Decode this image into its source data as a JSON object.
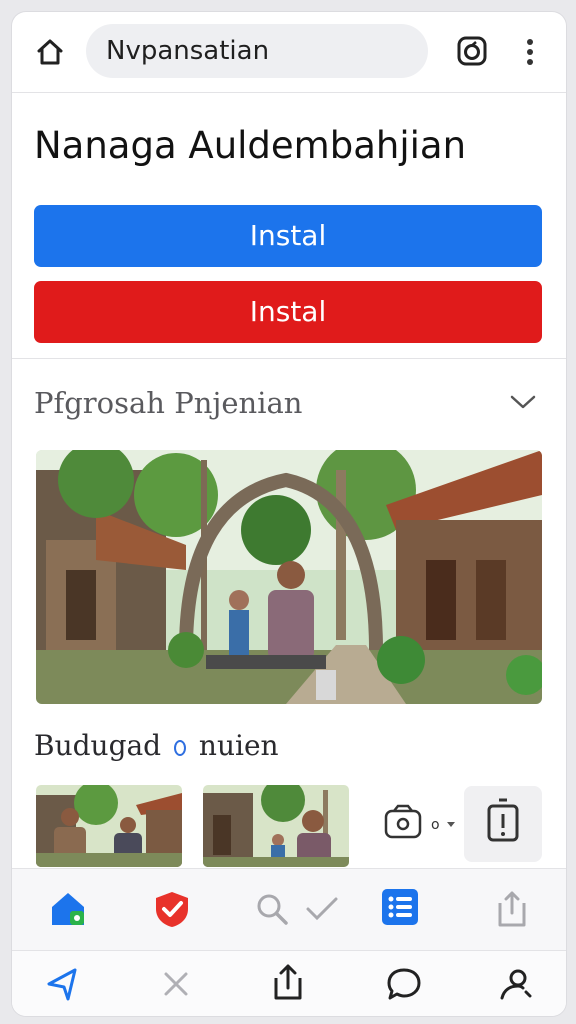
{
  "header": {
    "search_text": "Nvpansatian",
    "icons": [
      "home-icon",
      "ring-icon",
      "more-vertical-icon"
    ]
  },
  "page": {
    "title": "Nanaga Auldembahjian"
  },
  "buttons": {
    "primary_label": "Instal",
    "secondary_label": "Instal",
    "primary_color": "#1c74ec",
    "secondary_color": "#e01b1b"
  },
  "section1": {
    "title": "Pfgrosah Pnjenian",
    "icon": "chevron-down-icon"
  },
  "section2": {
    "title_before": "Budugad",
    "title_after": "nuien"
  },
  "tools": {
    "label": "o"
  },
  "tabbar": {
    "items": [
      "home-icon",
      "shield-check-icon",
      "search-icon",
      "check-icon",
      "list-icon",
      "share-icon"
    ],
    "active": "list-icon"
  },
  "navbar": {
    "items": [
      "send-icon",
      "close-icon",
      "upload-icon",
      "chat-icon",
      "profile-icon"
    ]
  }
}
